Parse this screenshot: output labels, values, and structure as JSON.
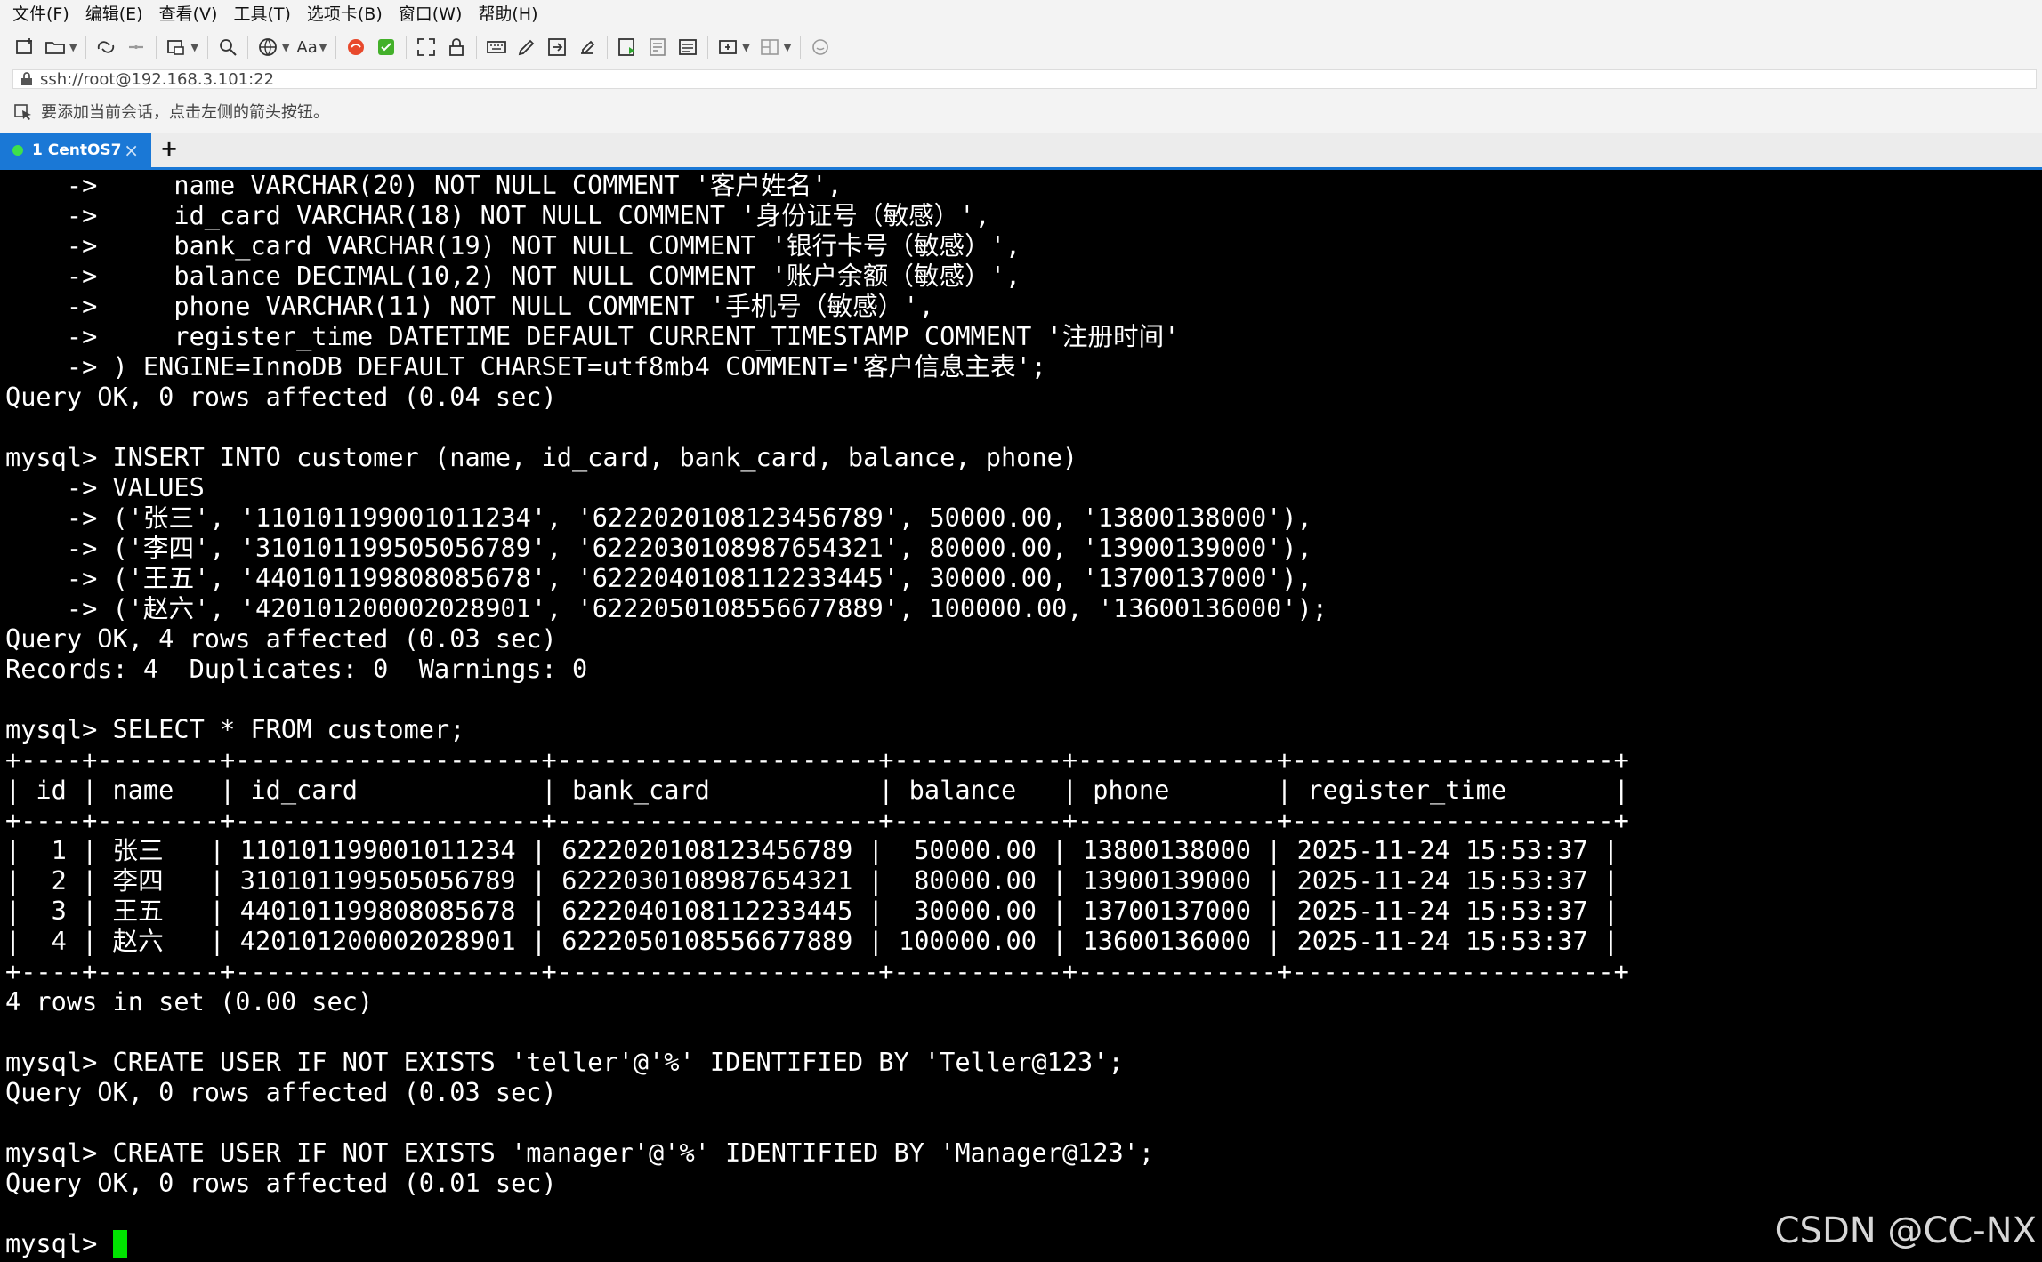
{
  "menu": [
    "文件(F)",
    "编辑(E)",
    "查看(V)",
    "工具(T)",
    "选项卡(B)",
    "窗口(W)",
    "帮助(H)"
  ],
  "toolbar": {
    "font_button_label": "Aa",
    "icons": [
      "new-session-icon",
      "open-folder-icon",
      "reconnect-icon",
      "disconnect-icon",
      "new-window-icon",
      "find-icon",
      "globe-icon",
      "font-icon",
      "red-logo-icon",
      "green-logo-icon",
      "fullscreen-icon",
      "lock-icon",
      "keyboard-icon",
      "script-icon",
      "transfer-icon",
      "edit-icon",
      "run-icon",
      "log-icon",
      "notes-icon",
      "new-tab-icon",
      "layout-icon",
      "chat-icon"
    ]
  },
  "address": {
    "value": "ssh://root@192.168.3.101:22"
  },
  "hint": {
    "text": "要添加当前会话，点击左侧的箭头按钮。"
  },
  "tabs": [
    {
      "label": "1 CentOS7",
      "close": "×",
      "status_color": "#3ee04b"
    }
  ],
  "new_tab_label": "+",
  "terminal": {
    "lines": [
      "    ->     name VARCHAR(20) NOT NULL COMMENT '客户姓名',",
      "    ->     id_card VARCHAR(18) NOT NULL COMMENT '身份证号（敏感）',",
      "    ->     bank_card VARCHAR(19) NOT NULL COMMENT '银行卡号（敏感）',",
      "    ->     balance DECIMAL(10,2) NOT NULL COMMENT '账户余额（敏感）',",
      "    ->     phone VARCHAR(11) NOT NULL COMMENT '手机号（敏感）',",
      "    ->     register_time DATETIME DEFAULT CURRENT_TIMESTAMP COMMENT '注册时间'",
      "    -> ) ENGINE=InnoDB DEFAULT CHARSET=utf8mb4 COMMENT='客户信息主表';",
      "Query OK, 0 rows affected (0.04 sec)",
      "",
      "mysql> INSERT INTO customer (name, id_card, bank_card, balance, phone)",
      "    -> VALUES",
      "    -> ('张三', '110101199001011234', '6222020108123456789', 50000.00, '13800138000'),",
      "    -> ('李四', '310101199505056789', '6222030108987654321', 80000.00, '13900139000'),",
      "    -> ('王五', '440101199808085678', '6222040108112233445', 30000.00, '13700137000'),",
      "    -> ('赵六', '420101200002028901', '6222050108556677889', 100000.00, '13600136000');",
      "Query OK, 4 rows affected (0.03 sec)",
      "Records: 4  Duplicates: 0  Warnings: 0",
      "",
      "mysql> SELECT * FROM customer;",
      "+----+--------+--------------------+---------------------+-----------+-------------+---------------------+",
      "| id | name   | id_card            | bank_card           | balance   | phone       | register_time       |",
      "+----+--------+--------------------+---------------------+-----------+-------------+---------------------+",
      "|  1 | 张三   | 110101199001011234 | 6222020108123456789 |  50000.00 | 13800138000 | 2025-11-24 15:53:37 |",
      "|  2 | 李四   | 310101199505056789 | 6222030108987654321 |  80000.00 | 13900139000 | 2025-11-24 15:53:37 |",
      "|  3 | 王五   | 440101199808085678 | 6222040108112233445 |  30000.00 | 13700137000 | 2025-11-24 15:53:37 |",
      "|  4 | 赵六   | 420101200002028901 | 6222050108556677889 | 100000.00 | 13600136000 | 2025-11-24 15:53:37 |",
      "+----+--------+--------------------+---------------------+-----------+-------------+---------------------+",
      "4 rows in set (0.00 sec)",
      "",
      "mysql> CREATE USER IF NOT EXISTS 'teller'@'%' IDENTIFIED BY 'Teller@123';",
      "Query OK, 0 rows affected (0.03 sec)",
      "",
      "mysql> CREATE USER IF NOT EXISTS 'manager'@'%' IDENTIFIED BY 'Manager@123';",
      "Query OK, 0 rows affected (0.01 sec)",
      ""
    ],
    "prompt": "mysql> ",
    "cursor_color": "#00e400"
  },
  "watermark": "CSDN @CC-NX"
}
